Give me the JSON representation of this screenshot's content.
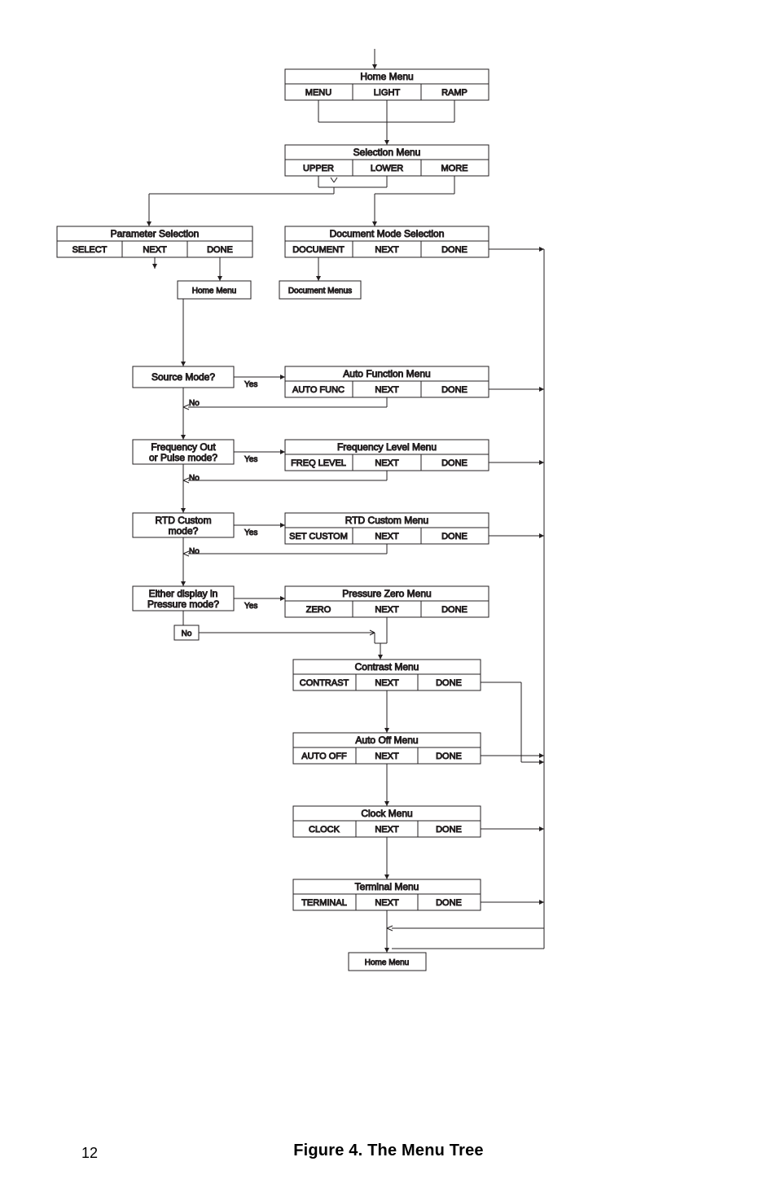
{
  "page_number": "12",
  "caption": "Figure 4. The Menu Tree",
  "home": {
    "title": "Home Menu",
    "b1": "MENU",
    "b2": "LIGHT",
    "b3": "RAMP"
  },
  "selection": {
    "title": "Selection Menu",
    "b1": "UPPER",
    "b2": "LOWER",
    "b3": "MORE"
  },
  "param": {
    "title": "Parameter Selection",
    "b1": "SELECT",
    "b2": "NEXT",
    "b3": "DONE"
  },
  "docmode": {
    "title": "Document Mode Selection",
    "b1": "DOCUMENT",
    "b2": "NEXT",
    "b3": "DONE"
  },
  "home_small": "Home Menu",
  "doc_menus": "Document Menus",
  "q1": "Source Mode?",
  "q2a": "Frequency Out",
  "q2b": "or Pulse mode?",
  "q3a": "RTD Custom",
  "q3b": "mode?",
  "q4a": "Either display in",
  "q4b": "Pressure mode?",
  "yes": "Yes",
  "no": "No",
  "autofunc": {
    "title": "Auto Function Menu",
    "b1": "AUTO FUNC",
    "b2": "NEXT",
    "b3": "DONE"
  },
  "freq": {
    "title": "Frequency Level Menu",
    "b1": "FREQ LEVEL",
    "b2": "NEXT",
    "b3": "DONE"
  },
  "rtd": {
    "title": "RTD Custom Menu",
    "b1": "SET CUSTOM",
    "b2": "NEXT",
    "b3": "DONE"
  },
  "zero": {
    "title": "Pressure Zero Menu",
    "b1": "ZERO",
    "b2": "NEXT",
    "b3": "DONE"
  },
  "contrast": {
    "title": "Contrast Menu",
    "b1": "CONTRAST",
    "b2": "NEXT",
    "b3": "DONE"
  },
  "autooff": {
    "title": "Auto Off Menu",
    "b1": "AUTO OFF",
    "b2": "NEXT",
    "b3": "DONE"
  },
  "clock": {
    "title": "Clock Menu",
    "b1": "CLOCK",
    "b2": "NEXT",
    "b3": "DONE"
  },
  "terminal": {
    "title": "Terminal Menu",
    "b1": "TERMINAL",
    "b2": "NEXT",
    "b3": "DONE"
  },
  "home_end": "Home Menu"
}
